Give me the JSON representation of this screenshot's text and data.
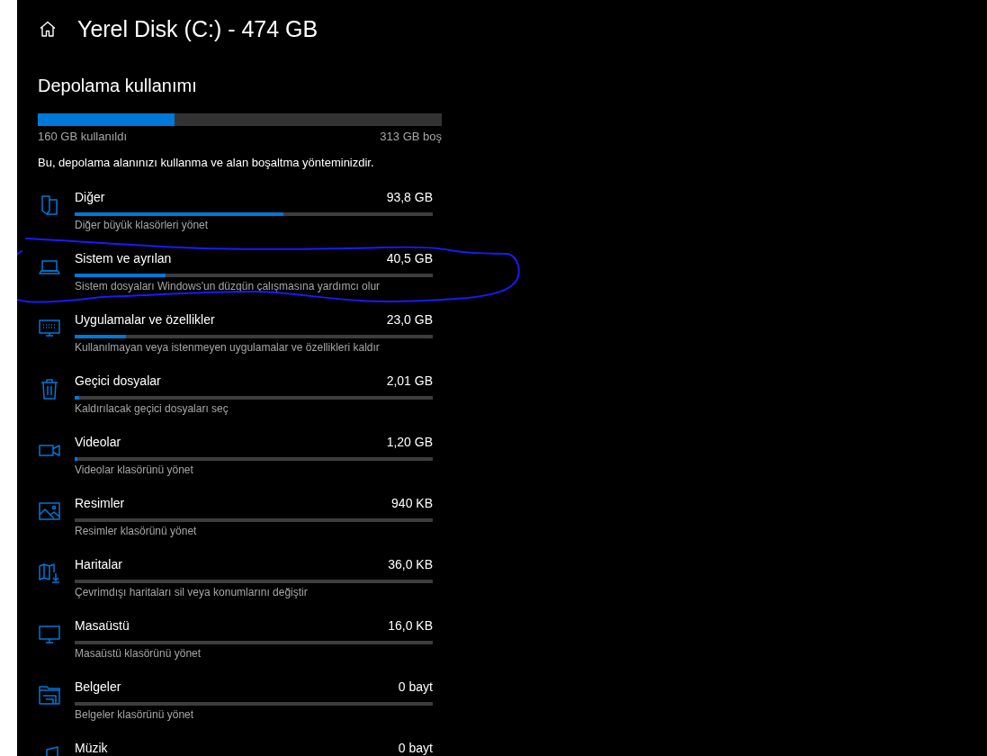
{
  "header": {
    "title": "Yerel Disk (C:) - 474 GB"
  },
  "usage": {
    "heading": "Depolama kullanımı",
    "level": 0.338,
    "used": "160 GB kullanıldı",
    "free": "313 GB boş",
    "description": "Bu, depolama alanınızı kullanma ve alan boşaltma yönteminizdir."
  },
  "categories": [
    {
      "name": "Diğer",
      "size": "93,8 GB",
      "level": 0.583,
      "description": "Diğer büyük klasörleri yönet"
    },
    {
      "name": "Sistem ve ayrılan",
      "size": "40,5 GB",
      "level": 0.253,
      "description": "Sistem dosyaları Windows'un düzgün çalışmasına yardımcı olur"
    },
    {
      "name": "Uygulamalar ve özellikler",
      "size": "23,0 GB",
      "level": 0.144,
      "description": "Kullanılmayan veya istenmeyen uygulamalar ve özellikleri kaldır"
    },
    {
      "name": "Geçici dosyalar",
      "size": "2,01 GB",
      "level": 0.0126,
      "description": "Kaldırılacak geçici dosyaları seç"
    },
    {
      "name": "Videolar",
      "size": "1,20 GB",
      "level": 0.0075,
      "description": "Videolar klasörünü yönet"
    },
    {
      "name": "Resimler",
      "size": "940 KB",
      "description": "Resimler klasörünü yönet"
    },
    {
      "name": "Haritalar",
      "size": "36,0 KB",
      "description": "Çevrimdışı haritaları sil veya konumlarını değiştir"
    },
    {
      "name": "Masaüstü",
      "size": "16,0 KB",
      "description": "Masaüstü klasörünü yönet"
    },
    {
      "name": "Belgeler",
      "size": "0 bayt",
      "description": "Belgeler klasörünü yönet"
    },
    {
      "name": "Müzik",
      "size": "0 bayt"
    }
  ]
}
